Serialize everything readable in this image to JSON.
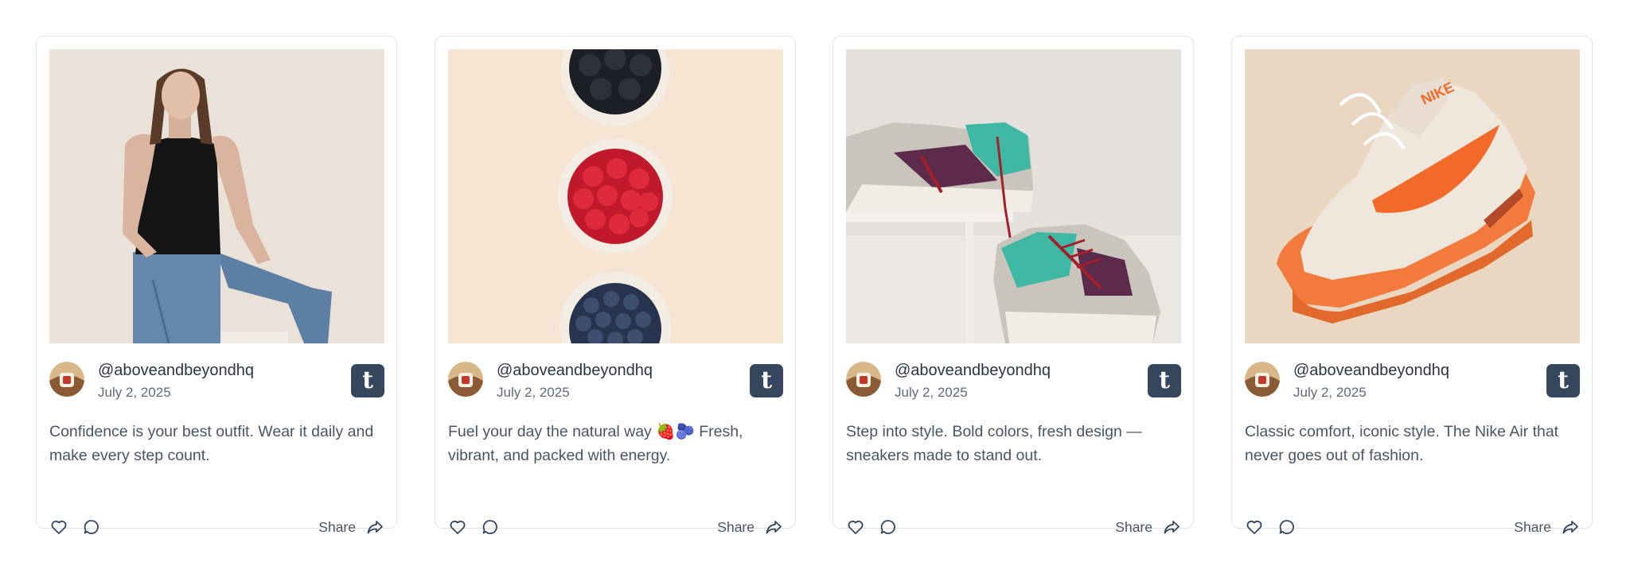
{
  "posts": [
    {
      "handle": "@aboveandbeyondhq",
      "date": "July 2, 2025",
      "caption": "Confidence is your best outfit. Wear it daily and make every step count.",
      "platform_glyph": "t",
      "share_label": "Share",
      "image": "woman in black tank top and jeans"
    },
    {
      "handle": "@aboveandbeyondhq",
      "date": "July 2, 2025",
      "caption": "Fuel your day the natural way 🍓🫐 Fresh, vibrant, and packed with energy.",
      "platform_glyph": "t",
      "share_label": "Share",
      "image": "bowls of blackberries, raspberries and blueberries"
    },
    {
      "handle": "@aboveandbeyondhq",
      "date": "July 2, 2025",
      "caption": "Step into style. Bold colors, fresh design — sneakers made to stand out.",
      "platform_glyph": "t",
      "share_label": "Share",
      "image": "two colorful sneakers on stand"
    },
    {
      "handle": "@aboveandbeyondhq",
      "date": "July 2, 2025",
      "caption": "Classic comfort, iconic style. The Nike Air that never goes out of fashion.",
      "platform_glyph": "t",
      "share_label": "Share",
      "image": "orange and cream Nike Air Max sneaker"
    }
  ],
  "colors": {
    "card_border": "#dfe3e8",
    "text_primary": "#2c3540",
    "text_secondary": "#5f6b78",
    "tumblr_badge": "#36465d"
  },
  "icons": {
    "like": "heart-icon",
    "comment": "comment-bubble-icon",
    "share": "share-arrow-icon",
    "platform": "tumblr-icon"
  }
}
